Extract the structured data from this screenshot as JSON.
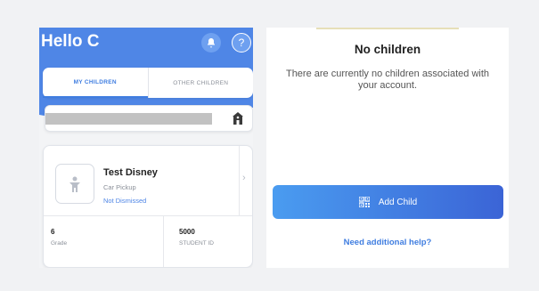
{
  "left": {
    "greeting": "Hello C",
    "tabs": [
      {
        "label": "MY CHILDREN",
        "active": true
      },
      {
        "label": "OTHER CHILDREN",
        "active": false
      }
    ],
    "child": {
      "name": "Test Disney",
      "pickup": "Car Pickup",
      "status": "Not Dismissed",
      "grade_value": "6",
      "grade_label": "Grade",
      "student_id_value": "5000",
      "student_id_label": "STUDENT ID"
    }
  },
  "right": {
    "title": "No children",
    "message": "There are currently no children associated with your account.",
    "add_child_label": "Add Child",
    "help_link": "Need additional help?"
  },
  "colors": {
    "header_blue": "#4f86e6",
    "accent_blue": "#3f7de0",
    "button_gradient_start": "#4a9cf0",
    "button_gradient_end": "#3b64d6"
  },
  "icons": [
    "bell-icon",
    "help-icon",
    "school-icon",
    "child-avatar-icon",
    "chevron-right-icon",
    "qr-code-icon"
  ]
}
